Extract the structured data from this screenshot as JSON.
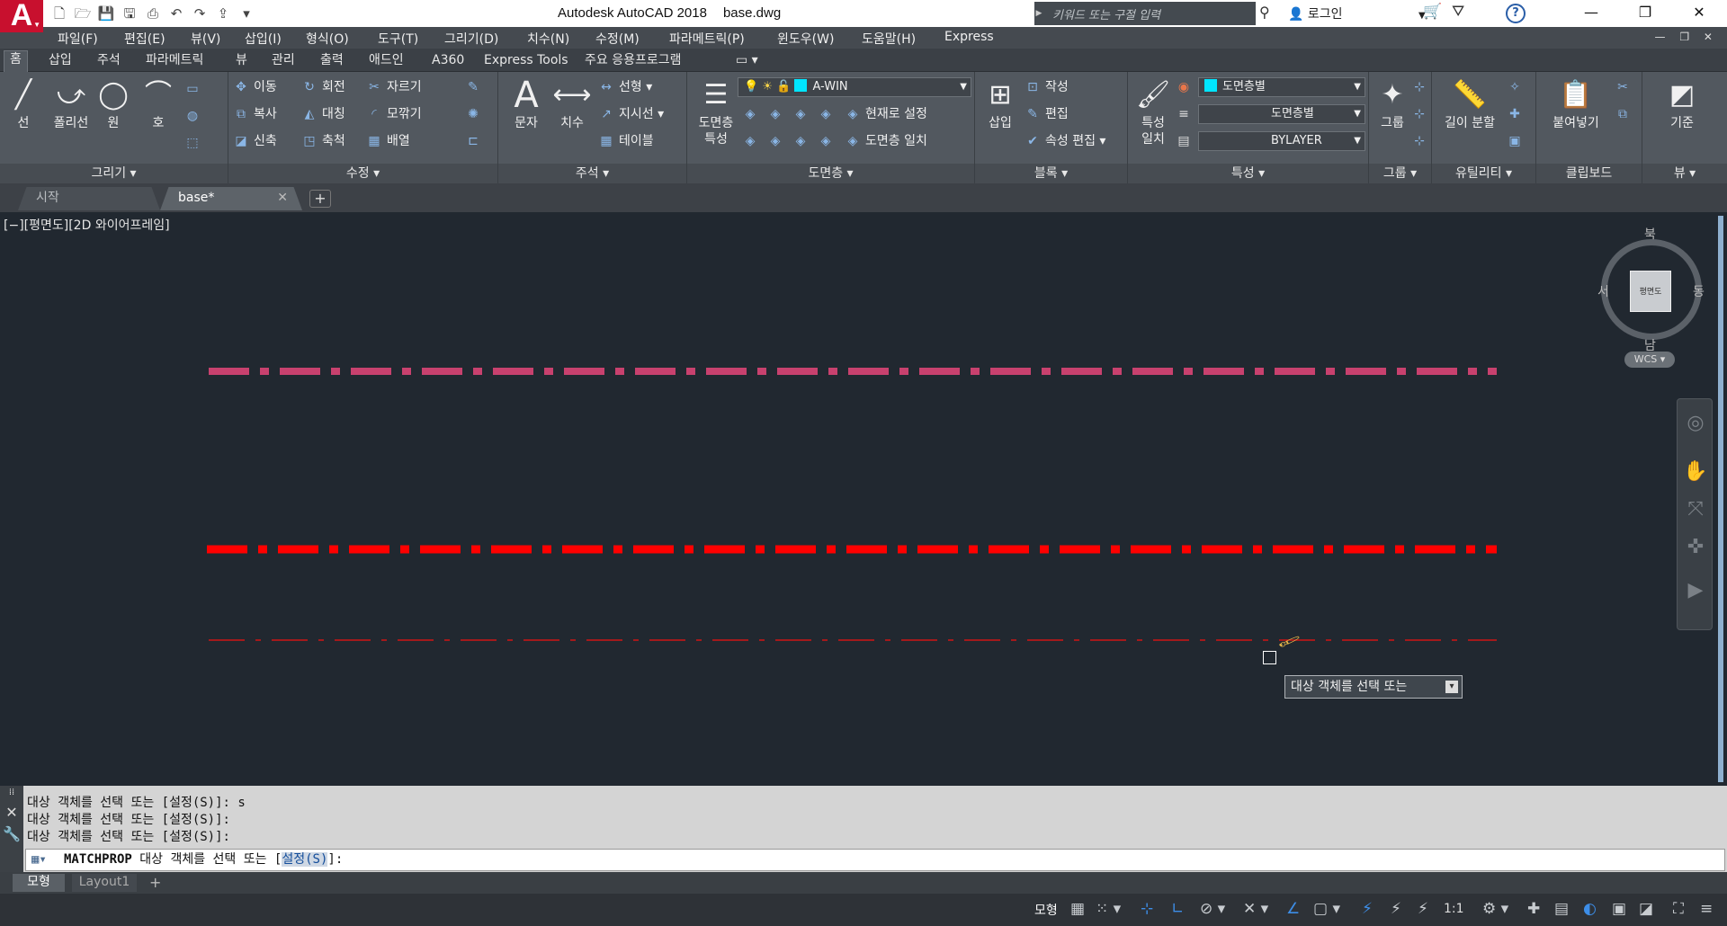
{
  "titlebar": {
    "logo": "A",
    "app_name": "Autodesk AutoCAD 2018",
    "file_name": "base.dwg",
    "search_placeholder": "키워드 또는 구절 입력",
    "login_label": "로그인"
  },
  "menu": [
    "파일(F)",
    "편집(E)",
    "뷰(V)",
    "삽입(I)",
    "형식(O)",
    "도구(T)",
    "그리기(D)",
    "치수(N)",
    "수정(M)",
    "파라메트릭(P)",
    "윈도우(W)",
    "도움말(H)",
    "Express"
  ],
  "ribbon_tabs": [
    "홈",
    "삽입",
    "주석",
    "파라메트릭",
    "뷰",
    "관리",
    "출력",
    "애드인",
    "A360",
    "Express Tools",
    "주요 응용프로그램"
  ],
  "ribbon": {
    "draw": {
      "footer": "그리기 ▾",
      "line": "선",
      "polyline": "폴리선",
      "circle": "원",
      "arc": "호"
    },
    "modify": {
      "footer": "수정 ▾",
      "move": "이동",
      "rotate": "회전",
      "trim": "자르기",
      "copy": "복사",
      "mirror": "대칭",
      "fillet": "모깎기",
      "stretch": "신축",
      "scale": "축척",
      "array": "배열"
    },
    "annotation": {
      "footer": "주석 ▾",
      "text": "문자",
      "dimension": "치수",
      "linear": "선형",
      "leader": "지시선",
      "table": "테이블"
    },
    "layers": {
      "footer": "도면층 ▾",
      "properties_line1": "도면층",
      "properties_line2": "특성",
      "current_layer": "A-WIN",
      "make_current": "현재로 설정",
      "match_layer": "도면층 일치"
    },
    "block": {
      "footer": "블록 ▾",
      "insert": "삽입",
      "create": "작성",
      "edit": "편집",
      "edit_attributes": "속성 편집"
    },
    "properties": {
      "footer": "특성 ▾",
      "match_line1": "특성",
      "match_line2": "일치",
      "color": "도면층별",
      "linetype": "도면층별",
      "lineweight": "BYLAYER"
    },
    "groups": {
      "footer": "그룹 ▾",
      "group": "그룹"
    },
    "utilities": {
      "footer": "유틸리티 ▾",
      "measure": "길이 분할"
    },
    "clipboard": {
      "footer": "클립보드",
      "paste": "붙여넣기"
    },
    "view": {
      "footer": "뷰 ▾",
      "base": "기준"
    }
  },
  "file_tabs": {
    "start": "시작",
    "document": "base*"
  },
  "viewport": {
    "label": "[−][평면도][2D 와이어프레임]",
    "viewcube": {
      "north": "북",
      "south": "남",
      "east": "동",
      "west": "서",
      "face": "평면도"
    },
    "wcs": "WCS ▾"
  },
  "drawing": {
    "lines": [
      {
        "color": "#c8416e",
        "pattern": "dash-dot heavy"
      },
      {
        "color": "#ff0000",
        "pattern": "dash-dot heavy"
      },
      {
        "color": "#d01414",
        "pattern": "dash-dot thin"
      }
    ]
  },
  "tooltip": "대상 객체를 선택 또는",
  "command": {
    "history": [
      "대상 객체를 선택 또는 [설정(S)]: s",
      "대상 객체를 선택 또는 [설정(S)]:",
      "대상 객체를 선택 또는 [설정(S)]:"
    ],
    "name": "MATCHPROP",
    "prompt_before": " 대상 객체를 선택 또는 [",
    "option": "설정(S)",
    "prompt_after": "]:"
  },
  "layout_tabs": {
    "model": "모형",
    "layout1": "Layout1"
  },
  "status": {
    "model": "모형",
    "scale": "1:1"
  }
}
